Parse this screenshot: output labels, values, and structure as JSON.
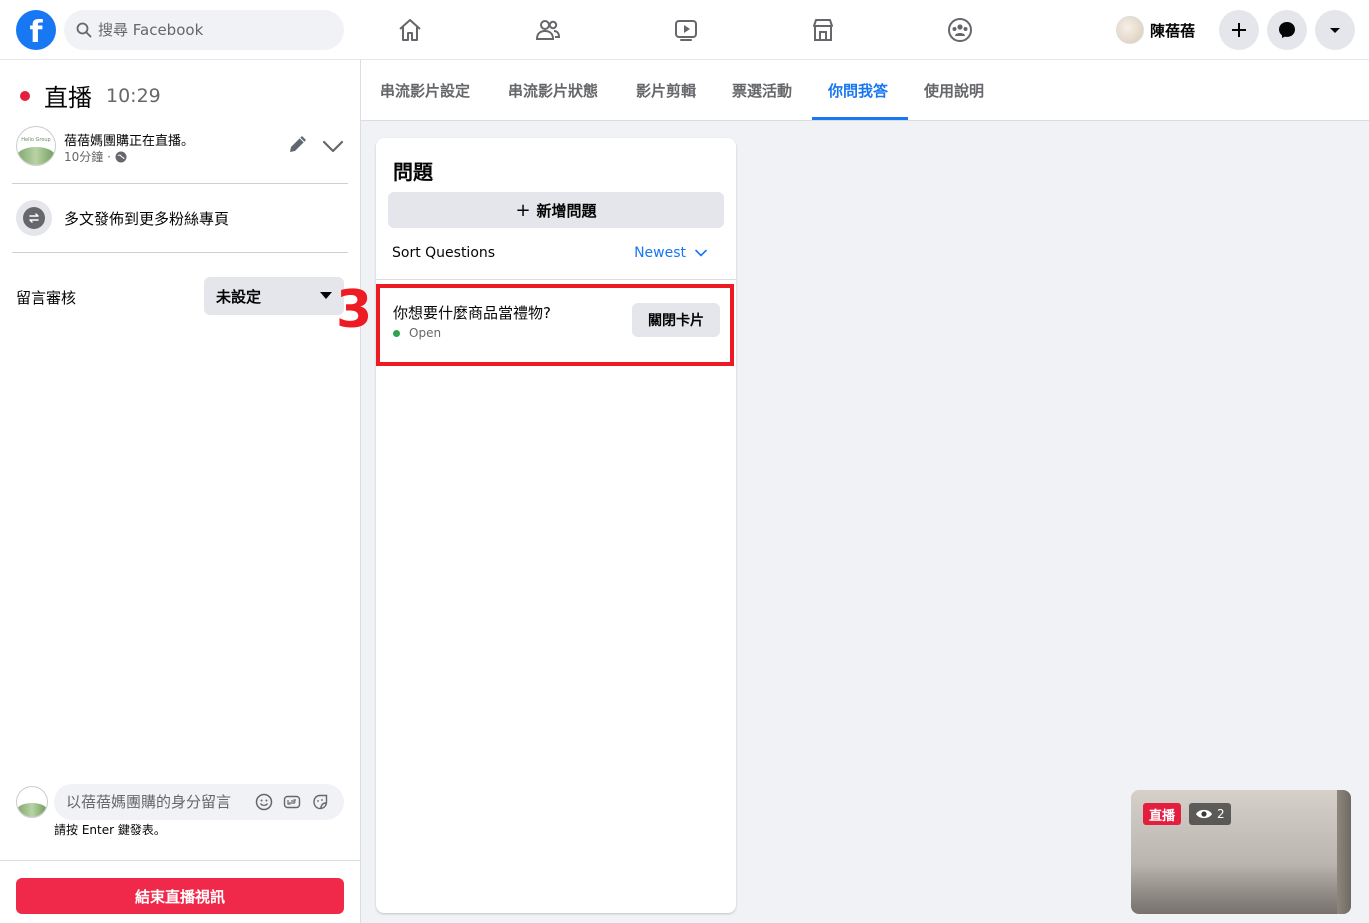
{
  "header": {
    "logo_letter": "f",
    "search_placeholder": "搜尋 Facebook",
    "nav_icons": [
      "home-icon",
      "friends-icon",
      "watch-icon",
      "marketplace-icon",
      "groups-icon"
    ],
    "profile_name": "陳蓓蓓",
    "right_buttons": [
      "plus-icon",
      "messenger-icon",
      "dropdown-icon"
    ],
    "accent_color": "#1877f2"
  },
  "left_panel": {
    "live_label": "直播",
    "elapsed_time": "10:29",
    "post": {
      "text": "蓓蓓媽團購正在直播。",
      "time": "10分鐘 ·",
      "avatar_text": "Hello Group"
    },
    "crosspost_label": "多文發佈到更多粉絲專頁",
    "moderation": {
      "label": "留言審核",
      "selected": "未設定"
    },
    "comment": {
      "placeholder": "以蓓蓓媽團購的身分留言",
      "hint": "請按 Enter 鍵發表。"
    },
    "end_button": "結束直播視訊",
    "end_color": "#f02849"
  },
  "tabs": [
    {
      "label": "串流影片設定"
    },
    {
      "label": "串流影片狀態"
    },
    {
      "label": "影片剪輯"
    },
    {
      "label": "票選活動"
    },
    {
      "label": "你問我答"
    },
    {
      "label": "使用說明"
    }
  ],
  "active_tab_index": 4,
  "questions": {
    "title": "問題",
    "add_button": "新增問題",
    "sort_label": "Sort Questions",
    "sort_value": "Newest",
    "items": [
      {
        "text": "你想要什麼商品當禮物?",
        "status": "Open",
        "action": "關閉卡片",
        "status_color": "#31a24c"
      }
    ]
  },
  "annotation": {
    "step_number": "3",
    "highlight_color": "#ed1c24"
  },
  "preview": {
    "live_badge": "直播",
    "viewer_count": "2"
  }
}
